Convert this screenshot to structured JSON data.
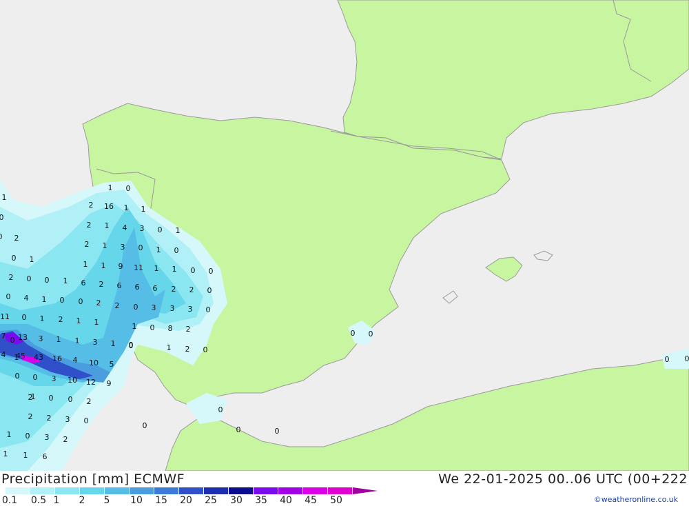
{
  "footer": {
    "title": "Precipitation [mm] ECMWF",
    "timestamp": "We 22-01-2025 00..06 UTC (00+222",
    "credit": "©weatheronline.co.uk"
  },
  "legend": {
    "ticks": [
      "0.1",
      "0.5",
      "1",
      "2",
      "5",
      "10",
      "15",
      "20",
      "25",
      "30",
      "35",
      "40",
      "45",
      "50"
    ],
    "colors": [
      "#d6f8fa",
      "#b0f0f6",
      "#8ae6f0",
      "#66d6ea",
      "#55bde6",
      "#4a9ee0",
      "#3c7ad8",
      "#2f50c8",
      "#1e2eb0",
      "#0c0c8e",
      "#7a0af0",
      "#a400e8",
      "#dc00e8",
      "#e000d0",
      "#a000a0"
    ]
  },
  "map": {
    "colors": {
      "sea": "#eeeeee",
      "land": "#c8f5a0",
      "border": "#9a9a9a"
    },
    "labels": [
      "1",
      "0",
      "2",
      "16",
      "1",
      "1",
      "2",
      "1",
      "4",
      "3",
      "0",
      "1",
      "2",
      "1",
      "3",
      "0",
      "1",
      "0",
      "1",
      "1",
      "9",
      "11",
      "1",
      "1",
      "0",
      "0",
      "6",
      "2",
      "6",
      "6",
      "6",
      "2",
      "2",
      "0",
      "2",
      "0",
      "3",
      "3",
      "3",
      "0",
      "1",
      "0",
      "8",
      "2",
      "1",
      "2",
      "0",
      "0",
      "1",
      "0",
      "0",
      "2",
      "0",
      "1",
      "2",
      "0",
      "0",
      "1",
      "0",
      "4",
      "1",
      "0",
      "0",
      "2",
      "11",
      "0",
      "1",
      "2",
      "1",
      "1",
      "7",
      "13",
      "3",
      "1",
      "1",
      "3",
      "1",
      "0",
      "4",
      "45",
      "43",
      "16",
      "4",
      "10",
      "5",
      "0",
      "0",
      "3",
      "10",
      "12",
      "9",
      "1",
      "0",
      "0",
      "2",
      "2",
      "2",
      "3",
      "0",
      "1",
      "0",
      "3",
      "2",
      "1",
      "1",
      "6",
      "0",
      "0",
      "0",
      "0",
      "0",
      "0",
      "0",
      "1",
      "0",
      "2",
      "0"
    ]
  }
}
